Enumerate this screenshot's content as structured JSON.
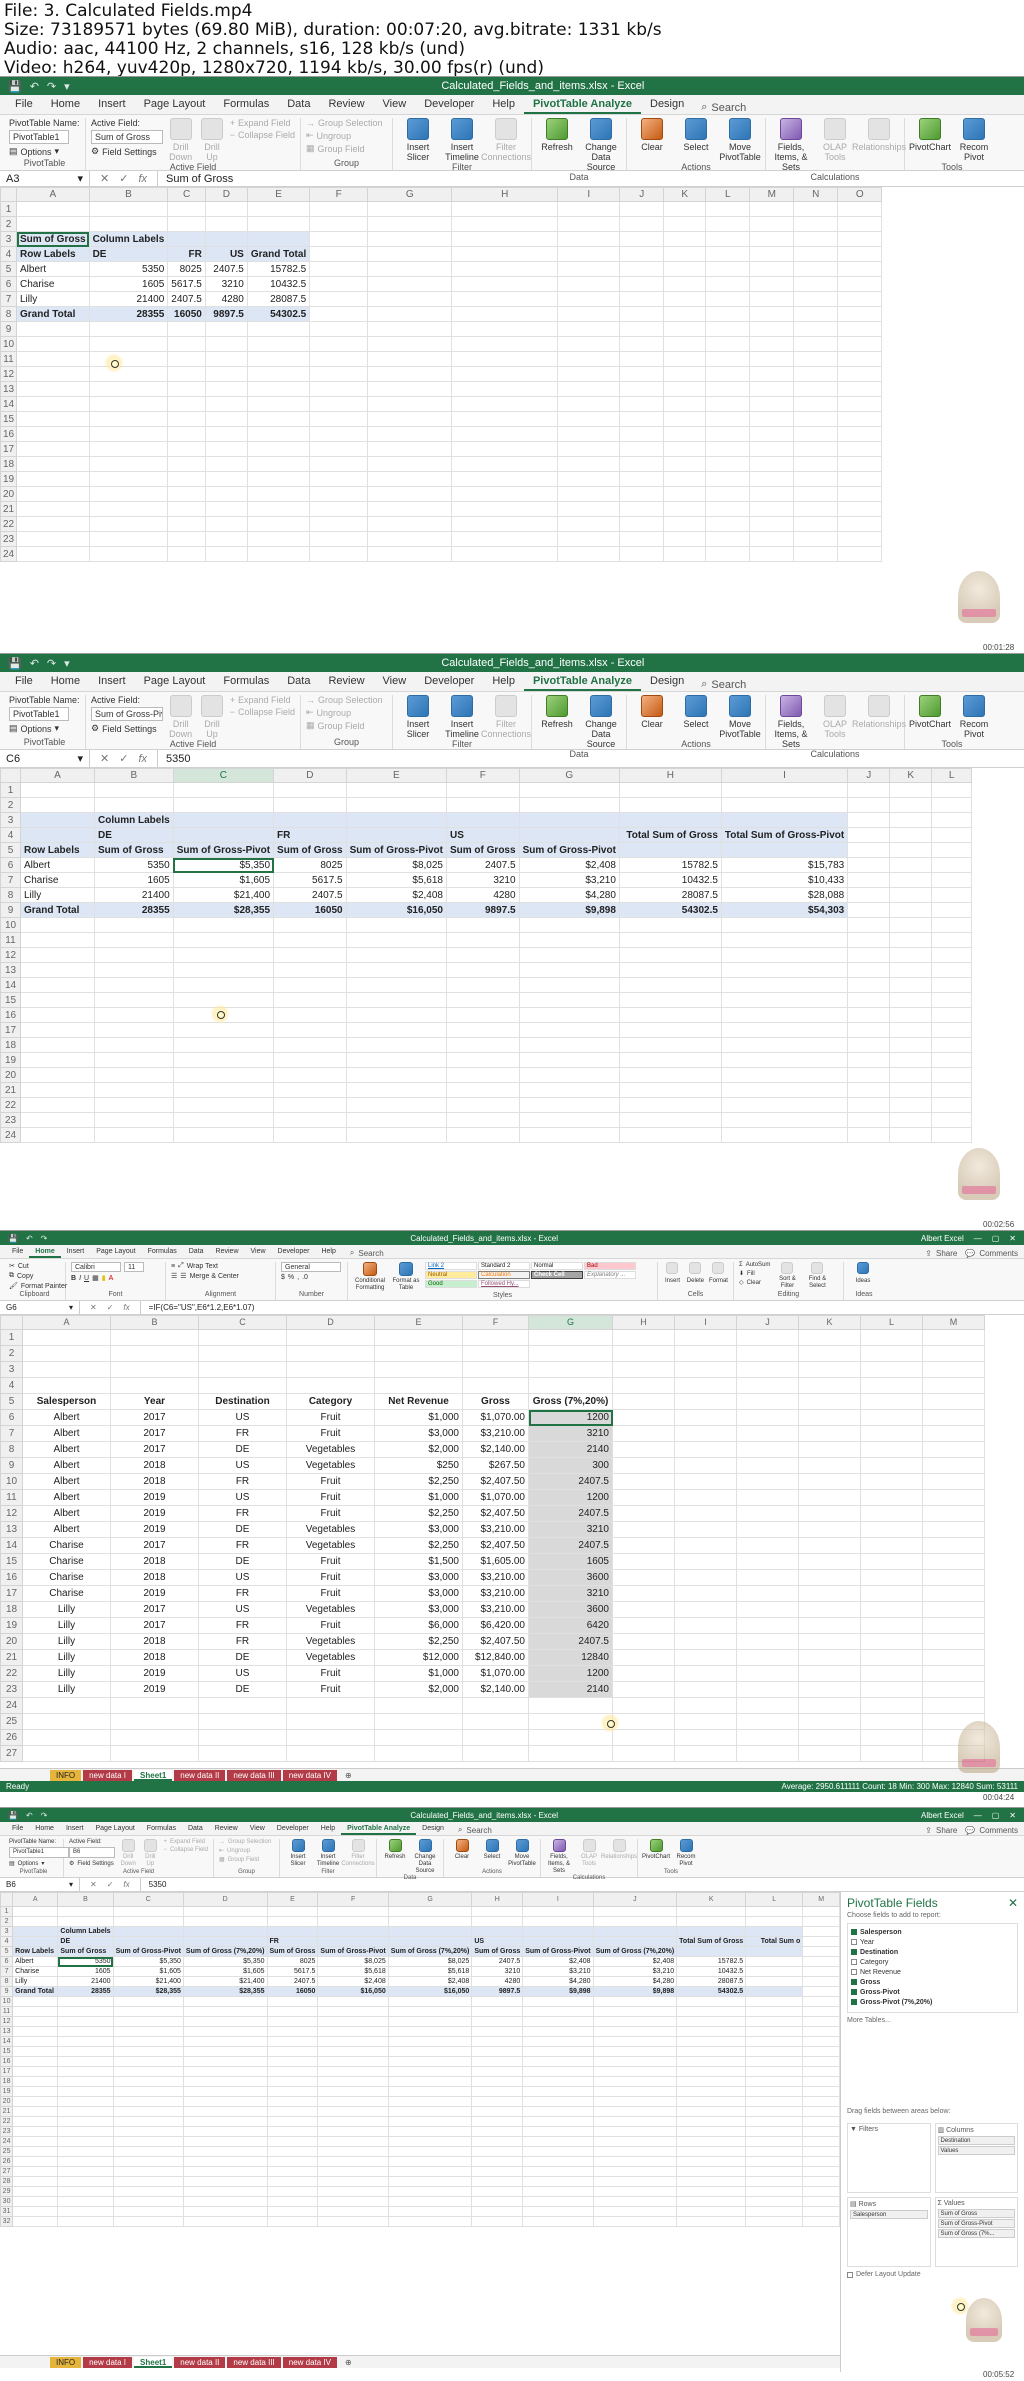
{
  "info": {
    "file": "File: 3. Calculated Fields.mp4",
    "size": "Size: 73189571 bytes (69.80 MiB), duration: 00:07:20, avg.bitrate: 1331 kb/s",
    "audio": "Audio: aac, 44100 Hz, 2 channels, s16, 128 kb/s (und)",
    "video": "Video: h264, yuv420p, 1280x720, 1194 kb/s, 30.00 fps(r) (und)"
  },
  "common": {
    "window_title": "Calculated_Fields_and_items.xlsx - Excel",
    "window_title_small": "Calculated_Fields_and_items.xlsx - Excel",
    "user": "Albert Excel",
    "search_label": "Search",
    "share": "Share",
    "comments": "Comments"
  },
  "menus_pt": [
    "File",
    "Home",
    "Insert",
    "Page Layout",
    "Formulas",
    "Data",
    "Review",
    "View",
    "Developer",
    "Help",
    "PivotTable Analyze",
    "Design"
  ],
  "menus_home": [
    "File",
    "Home",
    "Insert",
    "Page Layout",
    "Formulas",
    "Data",
    "Review",
    "View",
    "Developer",
    "Help"
  ],
  "ribbon_pt": {
    "pivottable_name_label": "PivotTable Name:",
    "pivottable_name": "PivotTable1",
    "options": "Options",
    "group_pivottable": "PivotTable",
    "active_field_label": "Active Field:",
    "field_settings": "Field Settings",
    "drill_down": "Drill Down",
    "drill_up": "Drill Up",
    "expand_field": "Expand Field",
    "collapse_field": "Collapse Field",
    "group_active_field": "Active Field",
    "group_selection": "Group Selection",
    "ungroup": "Ungroup",
    "group_field": "Group Field",
    "group_group": "Group",
    "insert_slicer": "Insert Slicer",
    "insert_timeline": "Insert Timeline",
    "filter_connections": "Filter Connections",
    "group_filter": "Filter",
    "refresh": "Refresh",
    "change_data_source": "Change Data Source",
    "group_data": "Data",
    "clear": "Clear",
    "select": "Select",
    "move_pivottable": "Move PivotTable",
    "group_actions": "Actions",
    "fields_items_sets": "Fields, Items, & Sets",
    "olap_tools": "OLAP Tools",
    "relationships": "Relationships",
    "group_calculations": "Calculations",
    "pivotchart": "PivotChart",
    "recommended": "Recom Pivot",
    "group_tools": "Tools"
  },
  "frame1": {
    "active_field": "Sum of Gross",
    "namebox": "A3",
    "formula": "Sum of Gross",
    "cols": [
      "A",
      "B",
      "C",
      "D",
      "E",
      "F",
      "G",
      "H",
      "I",
      "J",
      "K",
      "L",
      "M",
      "N",
      "O"
    ],
    "rows": [
      "1",
      "2",
      "3",
      "4",
      "5",
      "6",
      "7",
      "8",
      "9",
      "10",
      "11",
      "12",
      "13",
      "14",
      "15",
      "16",
      "17",
      "18",
      "19",
      "20",
      "21",
      "22",
      "23",
      "24"
    ],
    "pivot": {
      "corner": "Sum of Gross",
      "col_labels": "Column Labels",
      "row_labels": "Row Labels",
      "headers": [
        "DE",
        "FR",
        "US",
        "Grand Total"
      ],
      "rows": [
        {
          "label": "Albert",
          "v": [
            "5350",
            "8025",
            "2407.5",
            "15782.5"
          ]
        },
        {
          "label": "Charise",
          "v": [
            "1605",
            "5617.5",
            "3210",
            "10432.5"
          ]
        },
        {
          "label": "Lilly",
          "v": [
            "21400",
            "2407.5",
            "4280",
            "28087.5"
          ]
        }
      ],
      "total_label": "Grand Total",
      "totals": [
        "28355",
        "16050",
        "9897.5",
        "54302.5"
      ]
    },
    "stamp": "00:01:28"
  },
  "frame2": {
    "active_field": "Sum of Gross-Piv",
    "namebox": "C6",
    "formula": "5350",
    "cols": [
      "A",
      "B",
      "C",
      "D",
      "E",
      "F",
      "G",
      "H",
      "I",
      "J",
      "K",
      "L"
    ],
    "rows": [
      "1",
      "2",
      "3",
      "4",
      "5",
      "6",
      "7",
      "8",
      "9",
      "10",
      "11",
      "12",
      "13",
      "14",
      "15",
      "16",
      "17",
      "18",
      "19",
      "20",
      "21",
      "22",
      "23",
      "24"
    ],
    "pivot": {
      "col_labels": "Column Labels",
      "row_labels": "Row Labels",
      "groups": [
        "DE",
        "FR",
        "US"
      ],
      "sub_a": "Sum of Gross",
      "sub_b": "Sum of Gross-Pivot",
      "total_sum_gross": "Total Sum of Gross",
      "total_sum_pivot": "Total Sum of Gross-Pivot",
      "rows": [
        {
          "label": "Albert",
          "v": [
            "5350",
            "$5,350",
            "8025",
            "$8,025",
            "2407.5",
            "$2,408",
            "15782.5",
            "$15,783"
          ]
        },
        {
          "label": "Charise",
          "v": [
            "1605",
            "$1,605",
            "5617.5",
            "$5,618",
            "3210",
            "$3,210",
            "10432.5",
            "$10,433"
          ]
        },
        {
          "label": "Lilly",
          "v": [
            "21400",
            "$21,400",
            "2407.5",
            "$2,408",
            "4280",
            "$4,280",
            "28087.5",
            "$28,088"
          ]
        }
      ],
      "total_label": "Grand Total",
      "totals": [
        "28355",
        "$28,355",
        "16050",
        "$16,050",
        "9897.5",
        "$9,898",
        "54302.5",
        "$54,303"
      ]
    },
    "stamp": "00:02:56"
  },
  "frame3": {
    "namebox": "G6",
    "formula": "=IF(C6=\"US\",E6*1.2,E6*1.07)",
    "ribbon": {
      "cut": "Cut",
      "copy": "Copy",
      "format_painter": "Format Painter",
      "group_clipboard": "Clipboard",
      "font": "Calibri",
      "font_size": "11",
      "group_font": "Font",
      "wrap_text": "Wrap Text",
      "merge_center": "Merge & Center",
      "group_alignment": "Alignment",
      "number_format": "General",
      "group_number": "Number",
      "conditional": "Conditional Formatting",
      "format_as_table": "Format as Table",
      "style_link": "Link 2",
      "style_neutral": "Neutral",
      "style_standard": "Standard 2",
      "style_calc": "Calculation",
      "style_normal": "Normal",
      "style_check": "Check Cell",
      "style_bad": "Bad",
      "style_explanatory": "Explanatory ...",
      "style_good": "Good",
      "style_followed": "Followed Hy...",
      "group_styles": "Styles",
      "insert": "Insert",
      "delete": "Delete",
      "format": "Format",
      "group_cells": "Cells",
      "autosum": "AutoSum",
      "fill": "Fill",
      "clear": "Clear",
      "sort_filter": "Sort & Filter",
      "find_select": "Find & Select",
      "group_editing": "Editing",
      "ideas": "Ideas",
      "group_ideas": "Ideas"
    },
    "cols": [
      "A",
      "B",
      "C",
      "D",
      "E",
      "F",
      "G",
      "H",
      "I",
      "J",
      "K",
      "L",
      "M"
    ],
    "headers": [
      "Salesperson",
      "Year",
      "Destination",
      "Category",
      "Net Revenue",
      "Gross",
      "Gross (7%,20%)"
    ],
    "data": [
      [
        "Albert",
        "2017",
        "US",
        "Fruit",
        "$1,000",
        "$1,070.00",
        "1200"
      ],
      [
        "Albert",
        "2017",
        "FR",
        "Fruit",
        "$3,000",
        "$3,210.00",
        "3210"
      ],
      [
        "Albert",
        "2017",
        "DE",
        "Vegetables",
        "$2,000",
        "$2,140.00",
        "2140"
      ],
      [
        "Albert",
        "2018",
        "US",
        "Vegetables",
        "$250",
        "$267.50",
        "300"
      ],
      [
        "Albert",
        "2018",
        "FR",
        "Fruit",
        "$2,250",
        "$2,407.50",
        "2407.5"
      ],
      [
        "Albert",
        "2019",
        "US",
        "Fruit",
        "$1,000",
        "$1,070.00",
        "1200"
      ],
      [
        "Albert",
        "2019",
        "FR",
        "Fruit",
        "$2,250",
        "$2,407.50",
        "2407.5"
      ],
      [
        "Albert",
        "2019",
        "DE",
        "Vegetables",
        "$3,000",
        "$3,210.00",
        "3210"
      ],
      [
        "Charise",
        "2017",
        "FR",
        "Vegetables",
        "$2,250",
        "$2,407.50",
        "2407.5"
      ],
      [
        "Charise",
        "2018",
        "DE",
        "Fruit",
        "$1,500",
        "$1,605.00",
        "1605"
      ],
      [
        "Charise",
        "2018",
        "US",
        "Fruit",
        "$3,000",
        "$3,210.00",
        "3600"
      ],
      [
        "Charise",
        "2019",
        "FR",
        "Fruit",
        "$3,000",
        "$3,210.00",
        "3210"
      ],
      [
        "Lilly",
        "2017",
        "US",
        "Vegetables",
        "$3,000",
        "$3,210.00",
        "3600"
      ],
      [
        "Lilly",
        "2017",
        "FR",
        "Fruit",
        "$6,000",
        "$6,420.00",
        "6420"
      ],
      [
        "Lilly",
        "2018",
        "FR",
        "Vegetables",
        "$2,250",
        "$2,407.50",
        "2407.5"
      ],
      [
        "Lilly",
        "2018",
        "DE",
        "Vegetables",
        "$12,000",
        "$12,840.00",
        "12840"
      ],
      [
        "Lilly",
        "2019",
        "US",
        "Fruit",
        "$1,000",
        "$1,070.00",
        "1200"
      ],
      [
        "Lilly",
        "2019",
        "DE",
        "Fruit",
        "$2,000",
        "$2,140.00",
        "2140"
      ]
    ],
    "tabs": [
      "INFO",
      "new data I",
      "Sheet1",
      "new data II",
      "new data III",
      "new data IV"
    ],
    "status_left": "Ready",
    "status_stats": "Average: 2950.611111    Count: 18    Min: 300    Max: 12840    Sum: 53111",
    "stamp": "00:04:24"
  },
  "frame4": {
    "namebox": "B6",
    "formula": "5350",
    "col_labels": "Column Labels",
    "row_labels": "Row Labels",
    "groups": [
      "DE",
      "FR",
      "US"
    ],
    "subs": [
      "Sum of Gross",
      "Sum of Gross-Pivot",
      "Sum of Gross (7%,20%)"
    ],
    "total_heads": [
      "Total Sum of Gross",
      "Total Sum o"
    ],
    "rows": [
      {
        "label": "Albert",
        "v": [
          "5350",
          "$5,350",
          "$5,350",
          "8025",
          "$8,025",
          "$8,025",
          "2407.5",
          "$2,408",
          "$2,408",
          "15782.5"
        ]
      },
      {
        "label": "Charise",
        "v": [
          "1605",
          "$1,605",
          "$1,605",
          "5617.5",
          "$5,618",
          "$5,618",
          "3210",
          "$3,210",
          "$3,210",
          "10432.5"
        ]
      },
      {
        "label": "Lilly",
        "v": [
          "21400",
          "$21,400",
          "$21,400",
          "2407.5",
          "$2,408",
          "$2,408",
          "4280",
          "$4,280",
          "$4,280",
          "28087.5"
        ]
      }
    ],
    "total_label": "Grand Total",
    "totals": [
      "28355",
      "$28,355",
      "$28,355",
      "16050",
      "$16,050",
      "$16,050",
      "9897.5",
      "$9,898",
      "$9,898",
      "54302.5"
    ],
    "pane": {
      "title": "PivotTable Fields",
      "subtitle": "Choose fields to add to report:",
      "fields": [
        {
          "name": "Salesperson",
          "on": true
        },
        {
          "name": "Year",
          "on": false
        },
        {
          "name": "Destination",
          "on": true
        },
        {
          "name": "Category",
          "on": false
        },
        {
          "name": "Net Revenue",
          "on": false
        },
        {
          "name": "Gross",
          "on": true
        },
        {
          "name": "Gross-Pivot",
          "on": true
        },
        {
          "name": "Gross-Pivot (7%,20%)",
          "on": true
        }
      ],
      "more_tables": "More Tables...",
      "drag_label": "Drag fields between areas below:",
      "filters": "Filters",
      "columns": "Columns",
      "columns_items": [
        "Destination",
        "Values"
      ],
      "rows": "Rows",
      "rows_items": [
        "Salesperson"
      ],
      "values": "Values",
      "values_items": [
        "Sum of Gross",
        "Sum of Gross-Pivot",
        "Sum of Gross (7%..."
      ],
      "defer": "Defer Layout Update"
    },
    "tabs": [
      "INFO",
      "new data I",
      "Sheet1",
      "new data II",
      "new data III",
      "new data IV"
    ],
    "stamp": "00:05:52"
  }
}
